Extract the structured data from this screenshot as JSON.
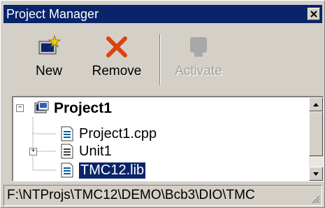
{
  "window": {
    "title": "Project Manager"
  },
  "toolbar": {
    "new_label": "New",
    "remove_label": "Remove",
    "activate_label": "Activate"
  },
  "tree": {
    "root": {
      "label": "Project1",
      "icon": "project-icon",
      "expanded": true
    },
    "children": [
      {
        "label": "Project1.cpp",
        "icon": "cpp-file-icon"
      },
      {
        "label": "Unit1",
        "icon": "unit-icon",
        "expandable": true
      },
      {
        "label": "TMC12.lib",
        "icon": "lib-file-icon",
        "selected": true
      }
    ]
  },
  "status": {
    "path": "F:\\NTProjs\\TMC12\\DEMO\\Bcb3\\DIO\\TMC"
  },
  "colors": {
    "titlebar": "#0a246a",
    "selection": "#0a246a",
    "face": "#d4d0c8"
  }
}
